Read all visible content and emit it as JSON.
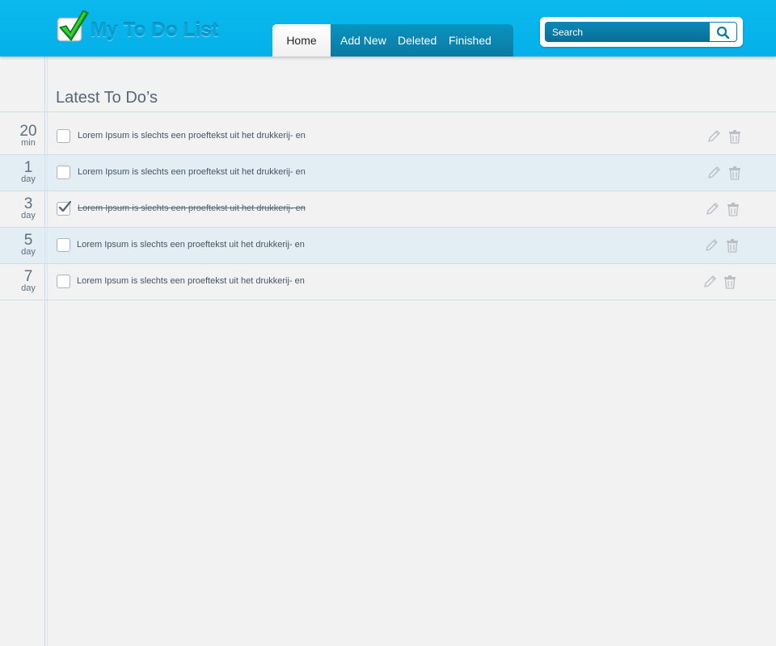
{
  "app": {
    "title": "My To Do List",
    "brand_color": "#04b0e8",
    "logo_icon": "checkmark-logo-icon"
  },
  "nav": {
    "tabs": [
      {
        "label": "Home",
        "active": true
      },
      {
        "label": "Add New",
        "active": false
      },
      {
        "label": "Deleted",
        "active": false
      },
      {
        "label": "Finished",
        "active": false
      }
    ]
  },
  "search": {
    "placeholder": "Search",
    "icon": "search-icon"
  },
  "main": {
    "title": "Latest To Do’s",
    "tasks": [
      {
        "when_value": "20",
        "when_unit": "min",
        "text": "Lorem Ipsum is slechts een proeftekst uit het drukkerij- en",
        "done": false
      },
      {
        "when_value": "1",
        "when_unit": "day",
        "text": "Lorem Ipsum is slechts een proeftekst uit het drukkerij- en",
        "done": false
      },
      {
        "when_value": "3",
        "when_unit": "day",
        "text": "Lorem Ipsum is slechts een proeftekst uit het drukkerij- en",
        "done": true
      },
      {
        "when_value": "5",
        "when_unit": "day",
        "text": "Lorem Ipsum is slechts een proeftekst uit het drukkerij- en",
        "done": false
      },
      {
        "when_value": "7",
        "when_unit": "day",
        "text": "Lorem Ipsum is slechts een proeftekst uit het drukkerij- en",
        "done": false
      }
    ],
    "row_icons": [
      "pencil-icon",
      "trash-icon"
    ]
  }
}
